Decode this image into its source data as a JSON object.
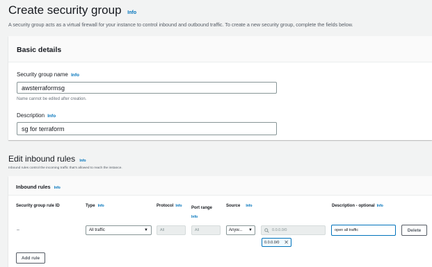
{
  "page": {
    "title": "Create security group",
    "title_info": "Info",
    "description": "A security group acts as a virtual firewall for your instance to control inbound and outbound traffic. To create a new security group, complete the fields below."
  },
  "basic_details": {
    "heading": "Basic details",
    "name_label": "Security group name",
    "name_info": "Info",
    "name_value": "awsterraformsg",
    "name_hint": "Name cannot be edited after creation.",
    "desc_label": "Description",
    "desc_info": "Info",
    "desc_value": "sg for terraform"
  },
  "inbound": {
    "title": "Edit inbound rules",
    "title_info": "Info",
    "description": "Inbound rules control the incoming traffic that's allowed to reach the instance.",
    "panel_heading": "Inbound rules",
    "panel_info": "Info",
    "columns": {
      "rule_id": "Security group rule ID",
      "type": "Type",
      "type_info": "Info",
      "protocol": "Protocol",
      "protocol_info": "Info",
      "port_range": "Port range",
      "port_info": "Info",
      "source": "Source",
      "source_info": "Info",
      "description": "Description - optional",
      "description_info": "Info"
    },
    "rule": {
      "rule_id": "–",
      "type": "All traffic",
      "protocol": "All",
      "port_range": "All",
      "source_type": "Anyw...",
      "source_search_placeholder": "0.0.0.0/0",
      "source_token": "0.0.0.0/0",
      "description": "open all traffic",
      "delete_label": "Delete"
    },
    "add_rule_label": "Add rule"
  },
  "colors": {
    "accent": "#0073bb",
    "focus": "#0073bb",
    "background": "#f2f3f3"
  }
}
